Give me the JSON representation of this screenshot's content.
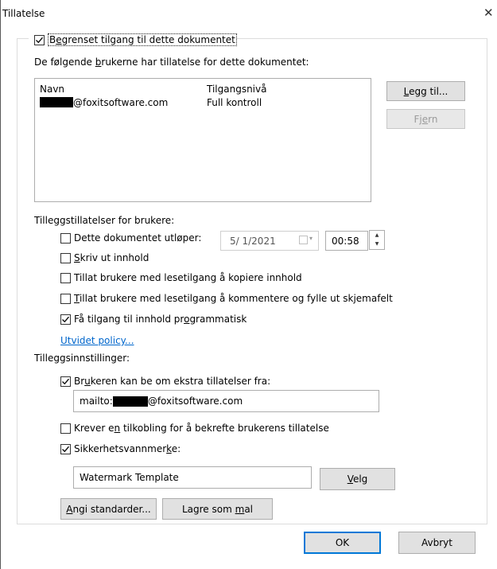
{
  "window": {
    "title": "Tillatelse"
  },
  "restrict": {
    "checkbox_checked": true,
    "label_pre": "B",
    "label_mn": "e",
    "label_post": "grenset tilgang til dette dokumentet"
  },
  "users": {
    "heading_pre": "De følgende ",
    "heading_mn": "b",
    "heading_post": "rukerne har tillatelse for dette dokumentet:",
    "col_name": "Navn",
    "col_access": "Tilgangsnivå",
    "rows": [
      {
        "email_suffix": "@foxitsoftware.com",
        "access": "Full kontroll"
      }
    ],
    "add_button_mn": "L",
    "add_button_post": "egg til...",
    "remove_button_pre": "Fj",
    "remove_button_mn": "e",
    "remove_button_post": "rn"
  },
  "extra_permissions": {
    "heading": "Tilleggstillatelser for brukere:",
    "expires": {
      "label": "Dette dokumentet utløper:",
      "checked": false,
      "date": "5/ 1/2021",
      "time": "00:58"
    },
    "print": {
      "label_mn": "S",
      "label_post": "kriv ut innhold",
      "checked": false
    },
    "copy": {
      "label": "Tillat brukere med lesetilgang å kopiere innhold",
      "checked": false
    },
    "comment": {
      "label_mn": "T",
      "label_post": "illat brukere med lesetilgang å kommentere og fylle ut skjemafelt",
      "checked": false
    },
    "programmatic": {
      "label_pre": "Få tilgang til innhold pr",
      "label_mn": "o",
      "label_post": "grammatisk",
      "checked": true
    },
    "advanced_link": "Utvidet policy..."
  },
  "extra_settings": {
    "heading": "Tilleggsinnstillinger:",
    "request_more": {
      "label_pre": "Br",
      "label_mn": "u",
      "label_post": "keren kan be om ekstra tillatelser fra:",
      "checked": true
    },
    "mailto_prefix": "mailto:",
    "mailto_suffix": "@foxitsoftware.com",
    "require_connection": {
      "label_pre": "Krever e",
      "label_mn": "n",
      "label_post": " tilkobling for å bekrefte brukerens tillatelse",
      "checked": false
    },
    "watermark": {
      "label_pre": "Sikkerhetsvannmer",
      "label_mn": "k",
      "label_post": "e:",
      "checked": true
    },
    "watermark_value": "Watermark Template",
    "choose_button_mn": "V",
    "choose_button_post": "elg",
    "defaults_button_mn": "A",
    "defaults_button_post": "ngi standarder...",
    "save_template_pre": "Lagre som ",
    "save_template_mn": "m",
    "save_template_post": "al"
  },
  "footer": {
    "ok": "OK",
    "cancel": "Avbryt"
  },
  "colors": {
    "link": "#0066cc",
    "accent_focus": "#0078d7",
    "button_face": "#e1e1e1"
  }
}
